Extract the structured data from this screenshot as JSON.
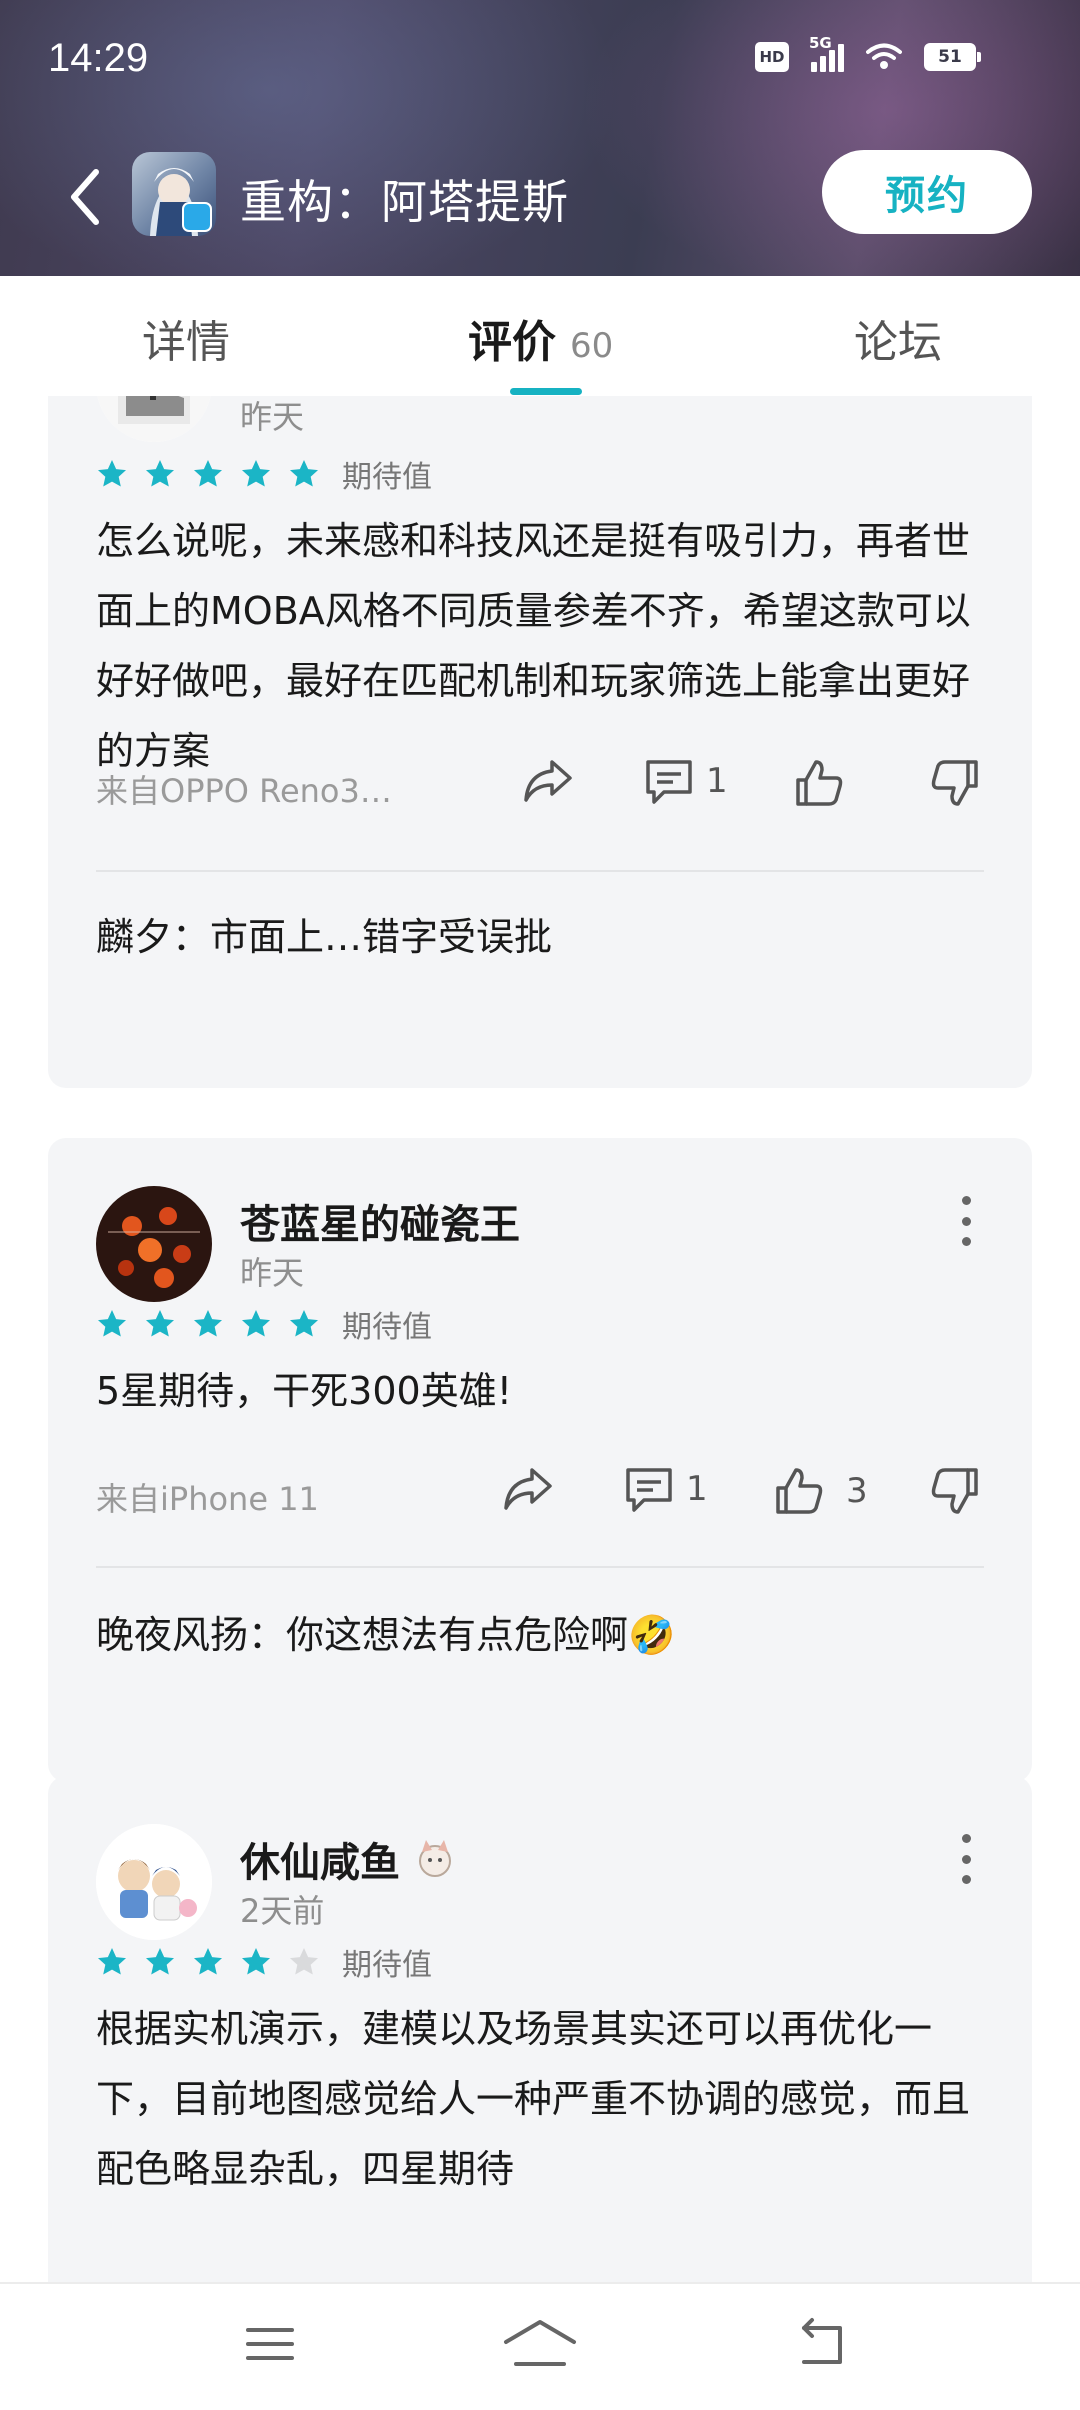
{
  "status_bar": {
    "time": "14:29",
    "hd_label": "HD",
    "network_label": "5G",
    "battery_level": "51"
  },
  "header": {
    "app_title": "重构：阿塔提斯",
    "reserve_label": "预约",
    "accent_color": "#16b2c2"
  },
  "tabs": {
    "detail": "详情",
    "review": "评价",
    "review_count": "60",
    "forum": "论坛"
  },
  "reviews": [
    {
      "username": "",
      "time": "昨天",
      "rating": 5,
      "rating_label": "期待值",
      "text": "怎么说呢，未来感和科技风还是挺有吸引力，再者世面上的MOBA风格不同质量参差不齐，希望这款可以好好做吧，最好在匹配机制和玩家筛选上能拿出更好的方案",
      "device": "来自OPPO Reno3…",
      "comment_count": "1",
      "like_count": "",
      "reply": "麟夕：市面上…错字受误批"
    },
    {
      "username": "苍蓝星的碰瓷王",
      "time": "昨天",
      "rating": 5,
      "rating_label": "期待值",
      "text": "5星期待，干死300英雄!",
      "device": "来自iPhone 11",
      "comment_count": "1",
      "like_count": "3",
      "reply": "晚夜风扬：你这想法有点危险啊🤣"
    },
    {
      "username": "休仙咸鱼",
      "time": "2天前",
      "rating": 4,
      "rating_label": "期待值",
      "text": "根据实机演示，建模以及场景其实还可以再优化一下，目前地图感觉给人一种严重不协调的感觉，而且配色略显杂乱，四星期待"
    }
  ],
  "icons": {
    "star_filled_color": "#1bb5c6",
    "star_empty_color": "#d9dadc"
  }
}
